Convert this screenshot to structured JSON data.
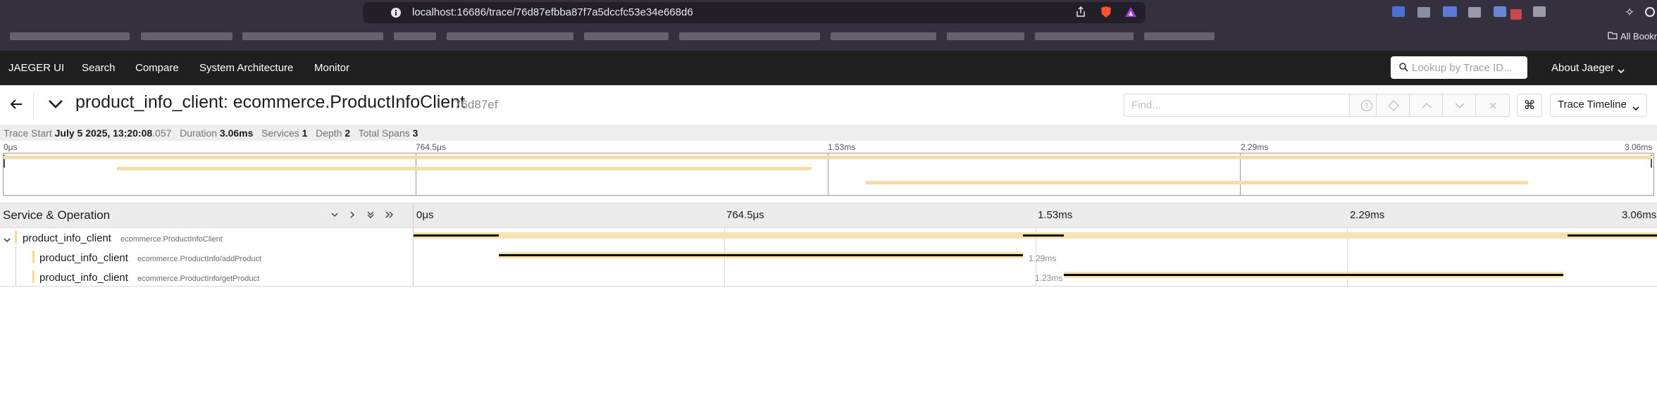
{
  "browser": {
    "url": "localhost:16686/trace/76d87efbba87f7a5dccfc53e34e668d6",
    "bookmarks_label": "All Bookm"
  },
  "nav": {
    "brand": "JAEGER UI",
    "items": [
      "Search",
      "Compare",
      "System Architecture",
      "Monitor"
    ],
    "lookup_placeholder": "Lookup by Trace ID...",
    "about": "About Jaeger"
  },
  "trace": {
    "title": "product_info_client: ecommerce.ProductInfoClient",
    "trace_id_short": "76d87ef",
    "find_placeholder": "Find...",
    "view_select": "Trace Timeline",
    "summary": {
      "trace_start_label": "Trace Start",
      "trace_start_main": "July 5 2025, 13:20:08",
      "trace_start_ms": ".057",
      "duration_label": "Duration",
      "duration": "3.06ms",
      "services_label": "Services",
      "services": "1",
      "depth_label": "Depth",
      "depth": "2",
      "total_spans_label": "Total Spans",
      "total_spans": "3"
    }
  },
  "timeline": {
    "ticks": [
      "0μs",
      "764.5μs",
      "1.53ms",
      "2.29ms",
      "3.06ms"
    ],
    "column_header": "Service & Operation",
    "duration_ms": 3.06
  },
  "spans": [
    {
      "service": "product_info_client",
      "operation": "ecommerce.ProductInfoClient",
      "start_ms": 0.0,
      "duration_ms": 3.06,
      "label": "",
      "depth": 0,
      "self_segments": [
        [
          0.0,
          0.21
        ],
        [
          1.5,
          1.6
        ],
        [
          2.84,
          3.06
        ]
      ]
    },
    {
      "service": "product_info_client",
      "operation": "ecommerce.ProductInfo/addProduct",
      "start_ms": 0.21,
      "duration_ms": 1.29,
      "label": "1.29ms",
      "depth": 1
    },
    {
      "service": "product_info_client",
      "operation": "ecommerce.ProductInfo/getProduct",
      "start_ms": 1.6,
      "duration_ms": 1.23,
      "label": "1.23ms",
      "depth": 1
    }
  ],
  "colors": {
    "span_fill": "#f8e3b0",
    "span_marker": "#f6d98e",
    "nav_bg": "#1f1f1f",
    "chrome_bg": "#35303d"
  }
}
